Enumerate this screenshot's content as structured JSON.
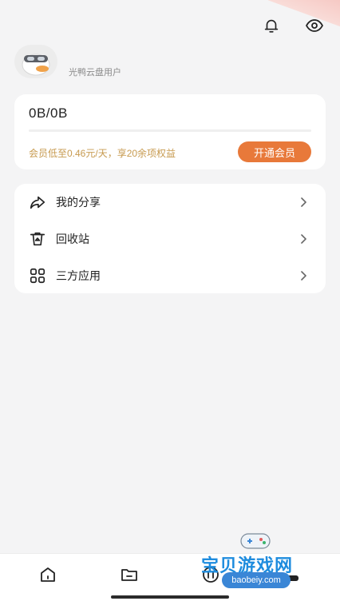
{
  "header": {
    "bell_icon": "bell-icon",
    "eye_icon": "eye-icon"
  },
  "profile": {
    "username": "光鸭云盘用户",
    "avatar_icon": "duck-avatar"
  },
  "storage": {
    "usage_text": "0B/0B",
    "used_fraction": 0,
    "promo_text": "会员低至0.46元/天，享20余项权益",
    "vip_button_label": "开通会员"
  },
  "menu": {
    "items": [
      {
        "label": "我的分享",
        "icon": "share-icon"
      },
      {
        "label": "回收站",
        "icon": "recycle-bin-icon"
      },
      {
        "label": "三方应用",
        "icon": "apps-grid-icon"
      }
    ]
  },
  "tabbar": {
    "tabs": [
      {
        "icon": "home-icon"
      },
      {
        "icon": "folder-icon"
      },
      {
        "icon": "transfer-icon"
      },
      {
        "icon": "profile-icon"
      }
    ]
  },
  "watermark": {
    "title": "宝贝游戏网",
    "url": "baobeiy.com"
  },
  "colors": {
    "accent": "#e8793a",
    "promo": "#c79a4f",
    "background": "#f4f4f5",
    "watermark_blue": "#1e8cde"
  }
}
